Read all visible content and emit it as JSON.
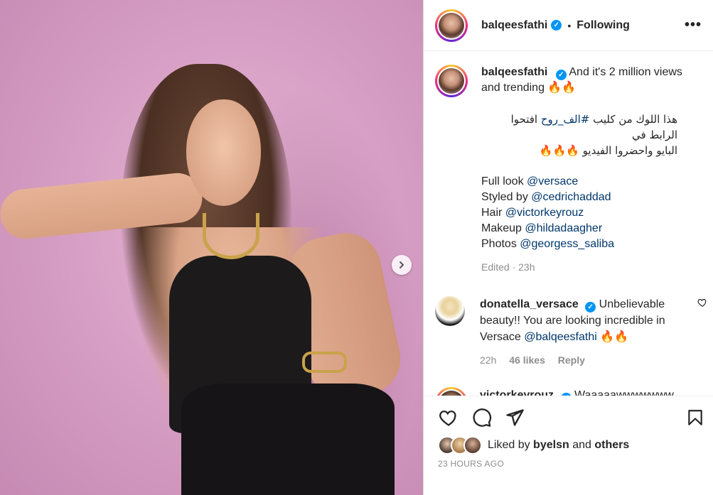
{
  "post": {
    "username": "balqeesfathi",
    "verified_badge": "✓",
    "follow_separator": "•",
    "follow_status": "Following",
    "more_label": "•••"
  },
  "caption": {
    "username": "balqeesfathi",
    "text_en": "And it's 2 million views and trending",
    "emoji_en": "🔥🔥",
    "arabic_line1_prefix": "هذا اللوك من كليب ",
    "arabic_hashtag": "#الف_روح",
    "arabic_line1_suffix": " افتحوا الرابط في",
    "arabic_line2": "البايو واحضروا الفيديو 🔥🔥🔥",
    "credits": [
      {
        "label": "Full look",
        "handle": "@versace"
      },
      {
        "label": "Styled by",
        "handle": "@cedrichaddad"
      },
      {
        "label": "Hair",
        "handle": "@victorkeyrouz"
      },
      {
        "label": "Makeup",
        "handle": "@hildadaagher"
      },
      {
        "label": "Photos",
        "handle": "@georgess_saliba"
      }
    ],
    "edited": "Edited · 23h"
  },
  "comments": [
    {
      "username": "donatella_versace",
      "text": "Unbelievable beauty!! You are looking incredible in Versace",
      "mention": "@balqeesfathi",
      "emoji": "🔥🔥",
      "time": "22h",
      "likes": "46 likes",
      "reply": "Reply"
    },
    {
      "username": "victorkeyrouz",
      "text": "Waaaaawwwwwww🔥",
      "emoji": "🔥🔥🔥"
    }
  ],
  "footer": {
    "liked_by_prefix": "Liked by",
    "liked_by_user": "byelsn",
    "liked_and": "and",
    "liked_others": "others",
    "timestamp": "23 HOURS AGO"
  },
  "icons": {
    "next": "chevron-right-icon",
    "like": "heart-icon",
    "comment": "comment-icon",
    "share": "share-icon",
    "save": "bookmark-icon"
  },
  "colors": {
    "verified": "#0095f6",
    "link": "#00376b",
    "muted": "#8e8e8e"
  }
}
